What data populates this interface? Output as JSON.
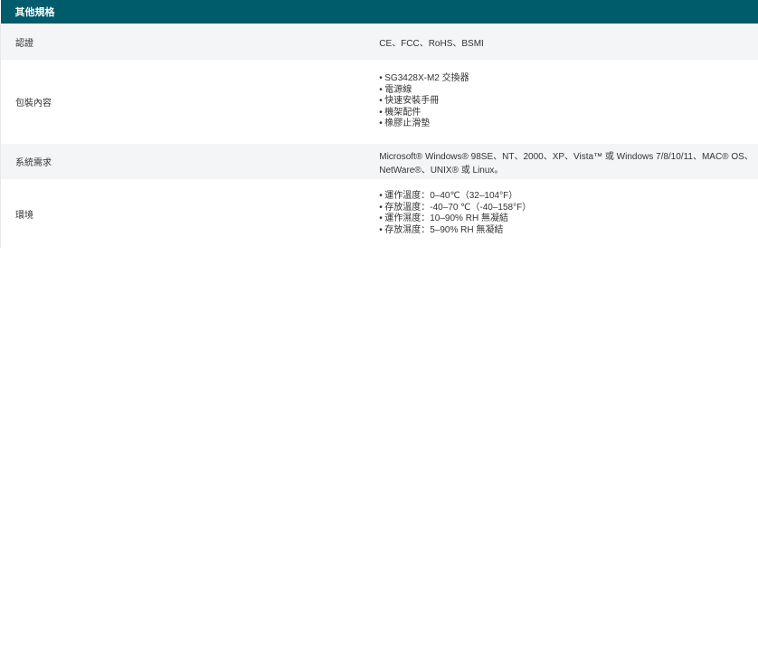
{
  "section_title": "其他規格",
  "rows": {
    "certification": {
      "label": "認證",
      "value": "CE、FCC、RoHS、BSMI"
    },
    "package": {
      "label": "包裝內容",
      "items": [
        "SG3428X-M2 交換器",
        "電源線",
        "快速安裝手冊",
        "機架配件",
        "橡膠止滑墊"
      ]
    },
    "system": {
      "label": "系統需求",
      "value": "Microsoft® Windows® 98SE、NT、2000、XP、Vista™ 或 Windows 7/8/10/11、MAC® OS、NetWare®、UNIX® 或 Linux。"
    },
    "environment": {
      "label": "環境",
      "items": [
        "運作溫度：0–40℃（32–104°F）",
        "存放溫度：-40–70 ℃（-40–158°F）",
        "運作濕度：10–90% RH 無凝結",
        "存放濕度：5–90% RH 無凝結"
      ]
    }
  },
  "bullet_char": "•",
  "colors": {
    "header_bg": "#005b6b",
    "header_text": "#ffffff",
    "row_shade": "#f4f5f6"
  }
}
